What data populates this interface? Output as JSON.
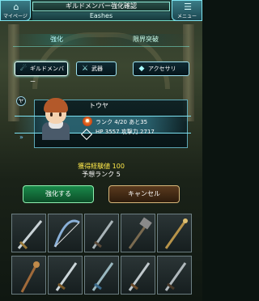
{
  "header": {
    "title": "ギルドメンバー強化確認",
    "subtitle": "Eashes",
    "left_button": "マイページ",
    "right_button": "メニュー"
  },
  "tabs": [
    {
      "label": "強化",
      "active": true
    },
    {
      "label": "限界突破",
      "active": false
    }
  ],
  "categories": [
    {
      "label": "ギルドメンバー",
      "icon": "ghost-icon",
      "selected": true
    },
    {
      "label": "武器",
      "icon": "sword-icon",
      "selected": false
    },
    {
      "label": "アクセサリ",
      "icon": "gem-icon",
      "selected": false
    }
  ],
  "character": {
    "badge": "ヤ",
    "name": "トウヤ",
    "rank_label": "ランク",
    "rank": "4/20",
    "next_label": "あと35",
    "hp_label": "HP",
    "hp": "3557",
    "atk_label": "攻撃力",
    "atk": "2717"
  },
  "exp": {
    "gain_text": "獲得経験値 100",
    "expected_text": "予想ランク 5"
  },
  "buttons": {
    "confirm": "強化する",
    "cancel": "キャンセル"
  },
  "materials": [
    {
      "name": "sword",
      "icon": "sword-icon"
    },
    {
      "name": "bow",
      "icon": "bow-icon"
    },
    {
      "name": "sword",
      "icon": "sword-icon"
    },
    {
      "name": "hammer",
      "icon": "hammer-icon"
    },
    {
      "name": "staff",
      "icon": "staff-icon"
    },
    {
      "name": "staff",
      "icon": "staff-icon"
    },
    {
      "name": "sword",
      "icon": "sword-icon"
    },
    {
      "name": "sword",
      "icon": "sword-icon"
    },
    {
      "name": "sword",
      "icon": "sword-icon"
    },
    {
      "name": "sword",
      "icon": "sword-icon"
    }
  ],
  "colors": {
    "accent": "#6fd7c4",
    "exp_yellow": "#ffe94a",
    "confirm_green": "#1a8a4a",
    "cancel_brown": "#5a3a1e"
  }
}
